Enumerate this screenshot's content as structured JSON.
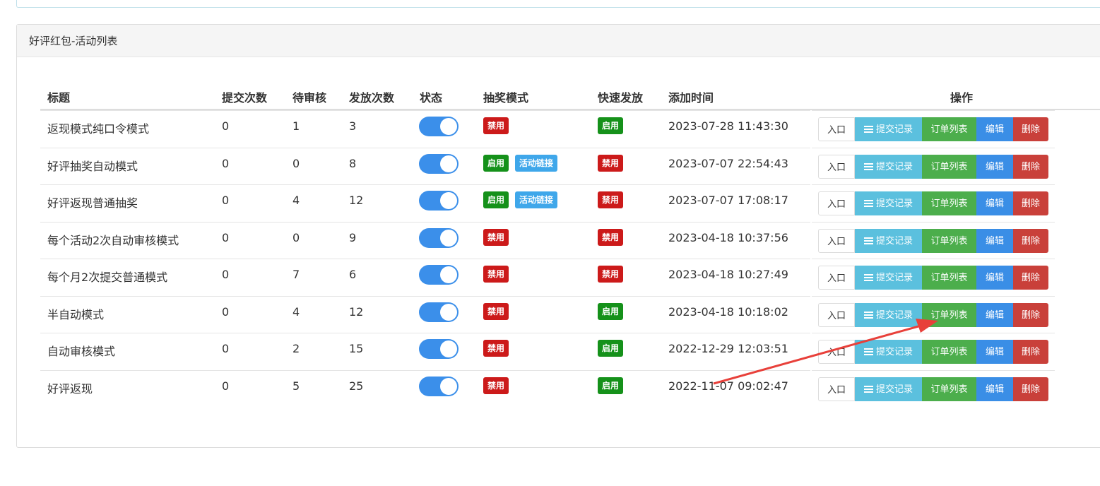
{
  "panel": {
    "title": "好评红包-活动列表"
  },
  "columns": {
    "title": "标题",
    "submissions": "提交次数",
    "pending": "待审核",
    "issued": "发放次数",
    "status": "状态",
    "lottery_mode": "抽奖模式",
    "fast_issue": "快速发放",
    "added_time": "添加时间",
    "actions": "操作"
  },
  "labels": {
    "disabled": "禁用",
    "enabled": "启用",
    "activity_link": "活动链接",
    "entry": "入口",
    "records": "提交记录",
    "orders": "订单列表",
    "edit": "编辑",
    "delete": "删除"
  },
  "rows": [
    {
      "title": "返现模式纯口令模式",
      "submissions": "0",
      "pending": "1",
      "issued": "3",
      "status_on": true,
      "lottery": "禁用",
      "lottery_link": false,
      "fast": "启用",
      "time": "2023-07-28 11:43:30"
    },
    {
      "title": "好评抽奖自动模式",
      "submissions": "0",
      "pending": "0",
      "issued": "8",
      "status_on": true,
      "lottery": "启用",
      "lottery_link": true,
      "fast": "禁用",
      "time": "2023-07-07 22:54:43"
    },
    {
      "title": "好评返现普通抽奖",
      "submissions": "0",
      "pending": "4",
      "issued": "12",
      "status_on": true,
      "lottery": "启用",
      "lottery_link": true,
      "fast": "禁用",
      "time": "2023-07-07 17:08:17"
    },
    {
      "title": "每个活动2次自动审核模式",
      "submissions": "0",
      "pending": "0",
      "issued": "9",
      "status_on": true,
      "lottery": "禁用",
      "lottery_link": false,
      "fast": "禁用",
      "time": "2023-04-18 10:37:56"
    },
    {
      "title": "每个月2次提交普通模式",
      "submissions": "0",
      "pending": "7",
      "issued": "6",
      "status_on": true,
      "lottery": "禁用",
      "lottery_link": false,
      "fast": "禁用",
      "time": "2023-04-18 10:27:49"
    },
    {
      "title": "半自动模式",
      "submissions": "0",
      "pending": "4",
      "issued": "12",
      "status_on": true,
      "lottery": "禁用",
      "lottery_link": false,
      "fast": "启用",
      "time": "2023-04-18 10:18:02"
    },
    {
      "title": "自动审核模式",
      "submissions": "0",
      "pending": "2",
      "issued": "15",
      "status_on": true,
      "lottery": "禁用",
      "lottery_link": false,
      "fast": "启用",
      "time": "2022-12-29 12:03:51"
    },
    {
      "title": "好评返现",
      "submissions": "0",
      "pending": "5",
      "issued": "25",
      "status_on": true,
      "lottery": "禁用",
      "lottery_link": false,
      "fast": "启用",
      "time": "2022-11-07 09:02:47"
    }
  ],
  "colors": {
    "disabled_badge": "#cc1a1a",
    "enabled_badge": "#15911a",
    "link_badge": "#3fa7ea",
    "toggle_on": "#3b8fea",
    "annotation_arrow": "#e8403a"
  },
  "icons": {
    "records_button": "list-icon"
  }
}
